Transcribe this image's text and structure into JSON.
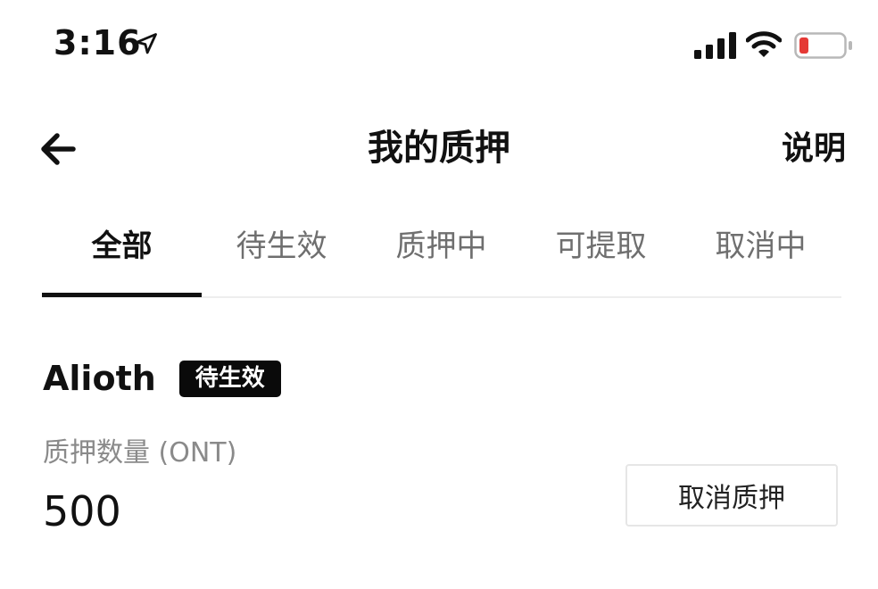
{
  "status_bar": {
    "time": "3:16",
    "icons": [
      "location-arrow-icon",
      "signal-icon",
      "wifi-icon",
      "battery-low-icon"
    ],
    "battery_color": "#e53935"
  },
  "nav": {
    "back_icon": "arrow-left-icon",
    "title": "我的质押",
    "help_label": "说明"
  },
  "tabs": [
    {
      "label": "全部",
      "active": true
    },
    {
      "label": "待生效",
      "active": false
    },
    {
      "label": "质押中",
      "active": false
    },
    {
      "label": "可提取",
      "active": false
    },
    {
      "label": "取消中",
      "active": false
    }
  ],
  "stake": {
    "node_name": "Alioth",
    "status": "待生效",
    "amount_label": "质押数量 (ONT)",
    "amount_value": "500",
    "cancel_label": "取消质押"
  },
  "colors": {
    "text_primary": "#111111",
    "text_secondary": "#8a8a8a",
    "tab_inactive": "#6f6f6f",
    "badge_bg": "#0a0a0a",
    "divider": "#eeeeee"
  }
}
